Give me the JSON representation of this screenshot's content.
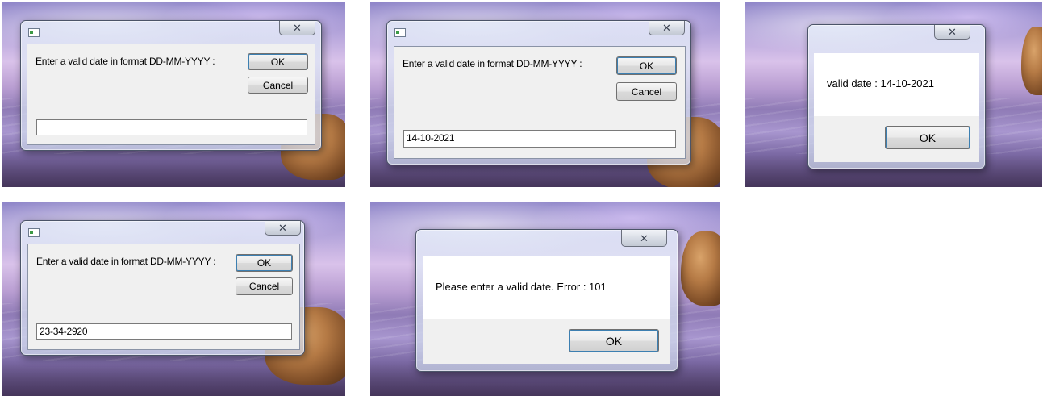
{
  "close_glyph": "✕",
  "input_dialogs": [
    {
      "prompt": "Enter a valid date in format DD-MM-YYYY :",
      "ok_label": "OK",
      "cancel_label": "Cancel",
      "input_value": ""
    },
    {
      "prompt": "Enter a valid date in format DD-MM-YYYY :",
      "ok_label": "OK",
      "cancel_label": "Cancel",
      "input_value": "14-10-2021"
    },
    {
      "prompt": "Enter a valid date in format DD-MM-YYYY :",
      "ok_label": "OK",
      "cancel_label": "Cancel",
      "input_value": "23-34-2920"
    }
  ],
  "message_boxes": [
    {
      "message": "valid date : 14-10-2021",
      "ok_label": "OK"
    },
    {
      "message": "Please enter a valid date. Error : 101",
      "ok_label": "OK"
    }
  ]
}
